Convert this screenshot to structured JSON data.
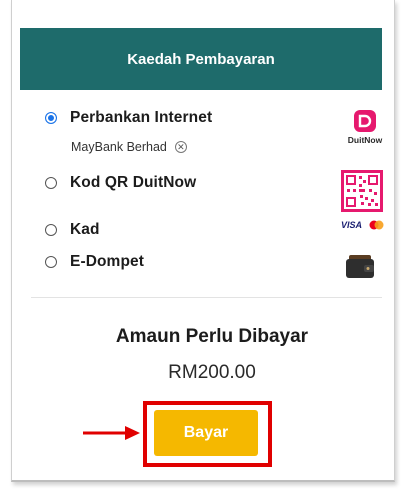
{
  "header": {
    "title": "Kaedah Pembayaran"
  },
  "payment_methods": [
    {
      "label": "Perbankan Internet",
      "selected": true,
      "selected_bank": "MayBank Berhad",
      "logo": "duitnow-logo",
      "logo_text": "DuitNow"
    },
    {
      "label": "Kod QR DuitNow",
      "selected": false,
      "logo": "qr-code-icon"
    },
    {
      "label": "Kad",
      "selected": false,
      "logo": "visa-mastercard-logo",
      "logo_text": "VISA"
    },
    {
      "label": "E-Dompet",
      "selected": false,
      "logo": "wallet-icon"
    }
  ],
  "summary": {
    "title": "Amaun Perlu Dibayar",
    "amount": "RM200.00"
  },
  "pay_button": {
    "label": "Bayar"
  },
  "colors": {
    "header_bg": "#1e6b6b",
    "pay_button_bg": "#f5b800",
    "highlight": "#e00000",
    "radio_selected": "#1a73e8",
    "duitnow_pink": "#e6196e"
  }
}
